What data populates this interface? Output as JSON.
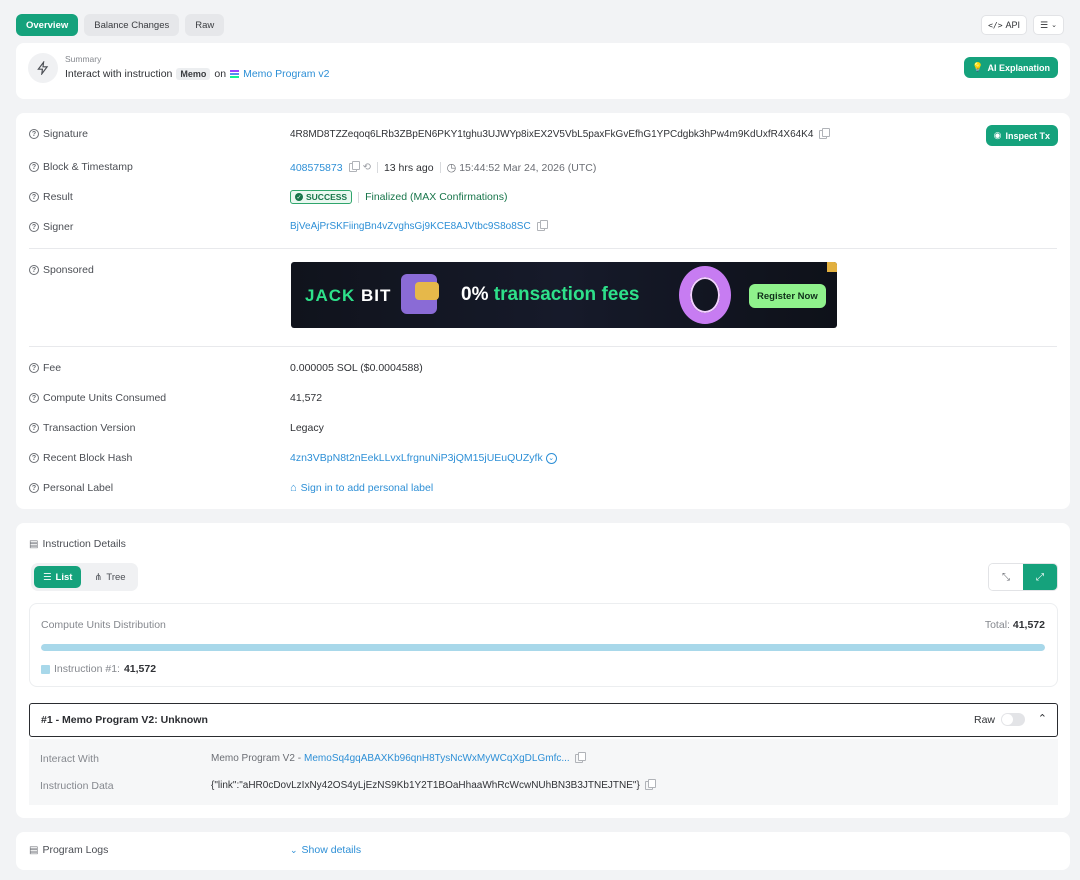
{
  "tabs": [
    "Overview",
    "Balance Changes",
    "Raw"
  ],
  "top_right": {
    "api_label": "API",
    "menu_icon": "list-icon"
  },
  "summary": {
    "caption": "Summary",
    "text_prefix": "Interact with instruction",
    "chip": "Memo",
    "on_word": "on",
    "program": "Memo Program v2",
    "ai_button": "AI Explanation"
  },
  "details": {
    "signature_label": "Signature",
    "signature": "4R8MD8TZZeqoq6LRb3ZBpEN6PKY1tghu3UJWYp8ixEX2V5VbL5paxFkGvEfhG1YPCdgbk3hPw4m9KdUxfR4X64K4",
    "inspect_button": "Inspect Tx",
    "block_label": "Block & Timestamp",
    "block": "408575873",
    "ago": "13 hrs ago",
    "timestamp": "15:44:52 Mar 24, 2026 (UTC)",
    "result_label": "Result",
    "result_badge": "SUCCESS",
    "result_text": "Finalized (MAX Confirmations)",
    "signer_label": "Signer",
    "signer": "BjVeAjPrSKFiingBn4vZvghsGj9KCE8AJVtbc9S8o8SC",
    "sponsored_label": "Sponsored",
    "banner": {
      "brand_a": "JACK",
      "brand_b": "BIT",
      "headline_a": "0%",
      "headline_b": "transaction fees",
      "cta": "Register Now"
    },
    "fee_label": "Fee",
    "fee": "0.000005 SOL ($0.0004588)",
    "cu_label": "Compute Units Consumed",
    "cu": "41,572",
    "version_label": "Transaction Version",
    "version": "Legacy",
    "blockhash_label": "Recent Block Hash",
    "blockhash": "4zn3VBpN8t2nEekLLvxLfrgnuNiP3jQM15jUEuQUZyfk",
    "personal_label": "Personal Label",
    "personal_link": "Sign in to add personal label"
  },
  "instructions": {
    "header": "Instruction Details",
    "view_list": "List",
    "view_tree": "Tree",
    "cu_dist_title": "Compute Units Distribution",
    "cu_total_label": "Total:",
    "cu_total": "41,572",
    "cu_fill_fraction": 1.0,
    "cu_legend_label": "Instruction #1:",
    "cu_legend_value": "41,572",
    "item_title": "#1 - Memo Program V2: Unknown",
    "raw_label": "Raw",
    "interact_label": "Interact With",
    "interact_prefix": "Memo Program V2 -",
    "interact_addr": "MemoSq4gqABAXKb96qnH8TysNcWxMyWCqXgDLGmfc...",
    "data_label": "Instruction Data",
    "data_value": "{\"link\":\"aHR0cDovLzIxNy42OS4yLjEzNS9Kb1Y2T1BOaHhaaWhRcWcwNUhBN3B3JTNEJTNE\"}"
  },
  "logs": {
    "label": "Program Logs",
    "toggle": "Show details"
  },
  "colors": {
    "accent": "#15a27c",
    "link": "#2d8fd6"
  }
}
